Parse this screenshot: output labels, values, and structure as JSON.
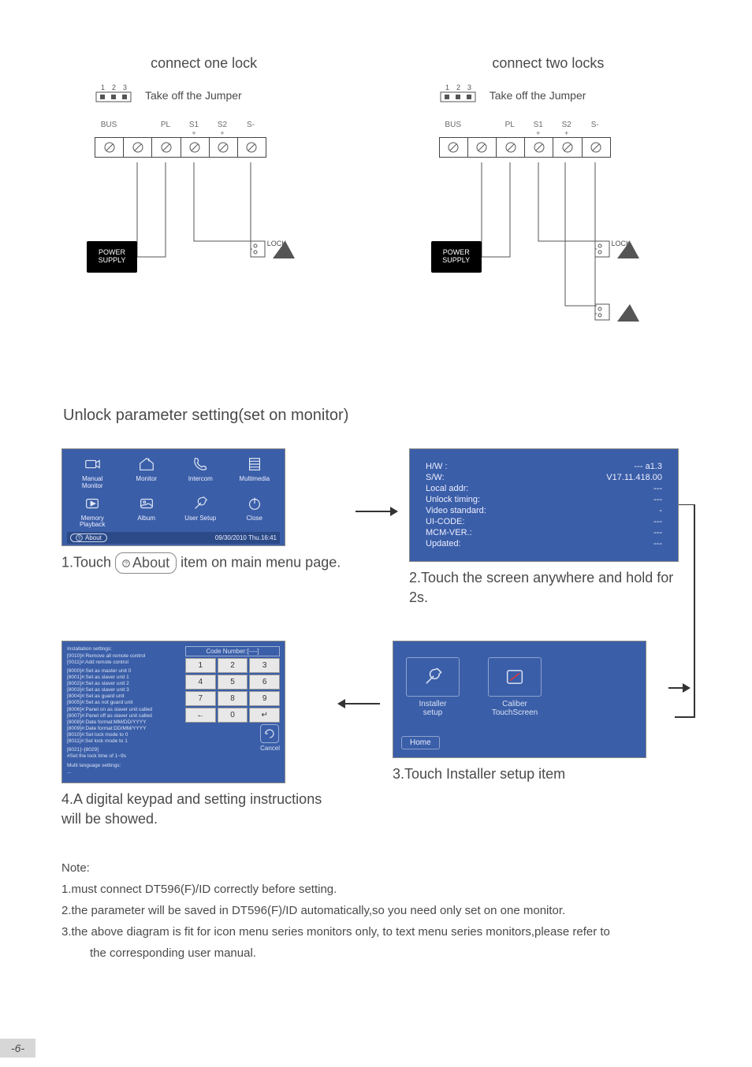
{
  "diagrams": {
    "one_lock_title": "connect one lock",
    "two_locks_title": "connect two locks",
    "jumper_pins": [
      "1",
      "2",
      "3"
    ],
    "jumper_text": "Take off the Jumper",
    "terminals": [
      "BUS",
      "",
      "PL",
      "S1",
      "S2",
      "S-"
    ],
    "terminals_sub": [
      "",
      "",
      "",
      "+",
      "+",
      ""
    ],
    "power_supply": "POWER\nSUPPLY",
    "lock_label": "LOCK"
  },
  "section_heading": "Unlock parameter setting(set on monitor)",
  "main_menu": {
    "items": [
      {
        "label": "Manual\nMonitor"
      },
      {
        "label": "Monitor"
      },
      {
        "label": "Intercom"
      },
      {
        "label": "Multimedia"
      },
      {
        "label": "Memory\nPlayback"
      },
      {
        "label": "Album"
      },
      {
        "label": "User Setup"
      },
      {
        "label": "Close"
      }
    ],
    "about_chip": "About",
    "datetime": "09/30/2010  Thu.16:41"
  },
  "step1_pre": "1.Touch ",
  "step1_post": " item on main menu page.",
  "about": {
    "rows": [
      {
        "k": "H/W :",
        "v": "---    a1.3"
      },
      {
        "k": "S/W:",
        "v": "V17.11.418.00"
      },
      {
        "k": "Local addr:",
        "v": "---"
      },
      {
        "k": "Unlock timing:",
        "v": "---"
      },
      {
        "k": "Video standard:",
        "v": "-"
      },
      {
        "k": "UI-CODE:",
        "v": "---"
      },
      {
        "k": "MCM-VER.:",
        "v": "---"
      },
      {
        "k": "Updated:",
        "v": "---"
      }
    ]
  },
  "step2": "2.Touch the screen anywhere and hold for 2s.",
  "keypad_screen": {
    "title": "Installation settings:",
    "lines_g1": [
      "[0010]#:Remove all remote control",
      "[0011]#:Add remote control"
    ],
    "lines_g2": [
      "[8000]#:Set as master unit 0",
      "[8001]#:Set as slaver unit 1",
      "[8002]#:Set as slaver unit 2",
      "[8003]#:Set as slaver unit 3",
      "[8004]#:Set as guard unit",
      "[8005]#:Set as not guard unit",
      "[8006]#:Panel on as slaver unit called",
      "[8007]#:Panel off as slaver unit called",
      "[8008]#:Date format:MM/DD/YYYY",
      "[8009]#:Date format:DD/MM/YYYY",
      "[8010]#:Set lock mode to 0",
      "[8011]#:Set lock mode to 1"
    ],
    "lines_g3": [
      "[8021]~[8029]",
      "    #Set the lock time of 1~9s"
    ],
    "lines_g4": [
      "Multi language settings:",
      "..."
    ],
    "code_label": "Code Number:[----]",
    "keys": [
      "1",
      "2",
      "3",
      "4",
      "5",
      "6",
      "7",
      "8",
      "9",
      "←",
      "0",
      "↵"
    ],
    "cancel": "Cancel"
  },
  "step4": "4.A digital keypad and setting instructions will be showed.",
  "installer": {
    "item1": "Installer\nsetup",
    "item2": "Caliber\nTouchScreen",
    "home": "Home"
  },
  "step3": "3.Touch Installer setup item",
  "note": {
    "title": "Note:",
    "l1": "1.must connect DT596(F)/ID correctly before setting.",
    "l2": "2.the parameter will be saved in DT596(F)/ID automatically,so you need only set on one monitor.",
    "l3": "3.the above diagram is fit for icon menu series monitors only, to text menu series monitors,please refer to",
    "l3b": "the corresponding user manual."
  },
  "page_number": "-6-"
}
